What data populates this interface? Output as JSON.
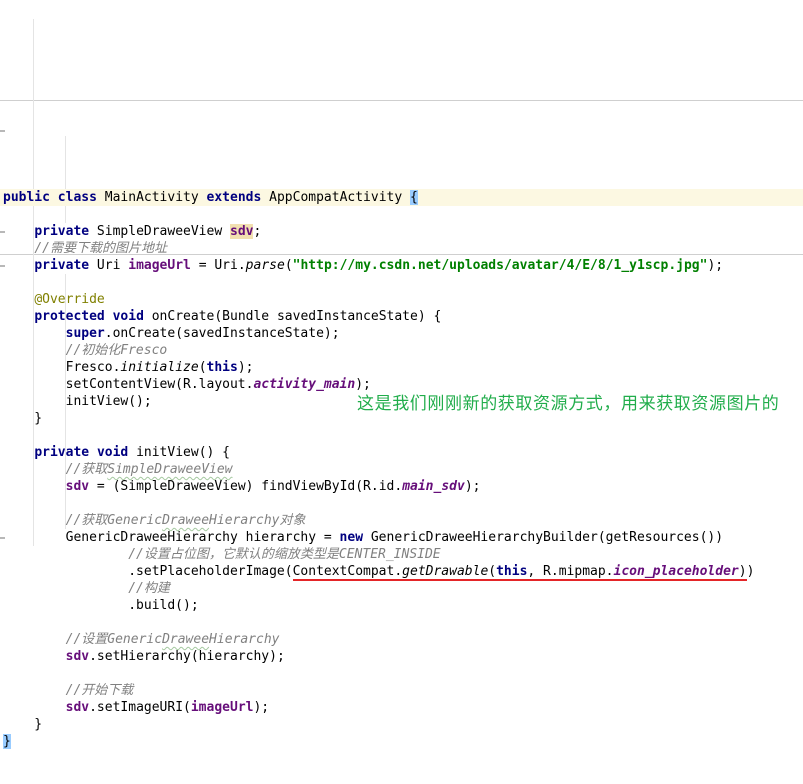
{
  "editor": {
    "note": {
      "text": "这是我们刚刚新的获取资源方式，用来获取资源图片的",
      "color": "#21AD4B"
    },
    "colors": {
      "keyword": "#000080",
      "field": "#660E7A",
      "string": "#008000",
      "comment": "#808080",
      "annotation": "#808000",
      "caret_row": "#FCF8E2",
      "brace_match": "#99CCFF",
      "decl_highlight": "#F2E0B0",
      "red_underline": "#E42528"
    },
    "lines": [
      {
        "cr": true,
        "t": [
          [
            "public",
            "k"
          ],
          [
            " ",
            "p"
          ],
          [
            "class",
            "k"
          ],
          [
            " MainActivity ",
            "p"
          ],
          [
            "extends",
            "k"
          ],
          [
            " AppCompatActivity ",
            "p"
          ],
          [
            "{",
            "p",
            "b"
          ]
        ]
      },
      {
        "t": []
      },
      {
        "t": [
          [
            "    ",
            "p"
          ],
          [
            "private",
            "k"
          ],
          [
            " SimpleDraweeView ",
            "p"
          ],
          [
            "sdv",
            "f",
            "h"
          ],
          [
            ";",
            "p"
          ]
        ]
      },
      {
        "t": [
          [
            "    ",
            "p"
          ],
          [
            "//需要下载的图片地址",
            "c"
          ]
        ]
      },
      {
        "t": [
          [
            "    ",
            "p"
          ],
          [
            "private",
            "k"
          ],
          [
            " Uri ",
            "p"
          ],
          [
            "imageUrl",
            "f"
          ],
          [
            " = Uri.",
            "p"
          ],
          [
            "parse",
            "m"
          ],
          [
            "(",
            "p"
          ],
          [
            "\"http://my.csdn.net/uploads/avatar/4/E/8/1_y1scp.jpg\"",
            "g"
          ],
          [
            ");",
            "p"
          ]
        ]
      },
      {
        "t": []
      },
      {
        "t": [
          [
            "    ",
            "p"
          ],
          [
            "@Override",
            "a"
          ]
        ]
      },
      {
        "t": [
          [
            "    ",
            "p"
          ],
          [
            "protected",
            "k"
          ],
          [
            " ",
            "p"
          ],
          [
            "void",
            "k"
          ],
          [
            " onCreate(Bundle savedInstanceState) {",
            "p"
          ]
        ]
      },
      {
        "t": [
          [
            "        ",
            "p"
          ],
          [
            "super",
            "k"
          ],
          [
            ".onCreate(savedInstanceState);",
            "p"
          ]
        ]
      },
      {
        "t": [
          [
            "        ",
            "p"
          ],
          [
            "//初始化Fresco",
            "c"
          ]
        ]
      },
      {
        "t": [
          [
            "        Fresco.",
            "p"
          ],
          [
            "initialize",
            "m"
          ],
          [
            "(",
            "p"
          ],
          [
            "this",
            "k"
          ],
          [
            ");",
            "p"
          ]
        ]
      },
      {
        "t": [
          [
            "        setContentView(R.layout.",
            "p"
          ],
          [
            "activity_main",
            "s"
          ],
          [
            ");",
            "p"
          ]
        ]
      },
      {
        "t": [
          [
            "        initView();",
            "p"
          ]
        ]
      },
      {
        "t": [
          [
            "    }",
            "p"
          ]
        ]
      },
      {
        "t": []
      },
      {
        "t": [
          [
            "    ",
            "p"
          ],
          [
            "private",
            "k"
          ],
          [
            " ",
            "p"
          ],
          [
            "void",
            "k"
          ],
          [
            " initView() {",
            "p"
          ]
        ]
      },
      {
        "t": [
          [
            "        ",
            "p"
          ],
          [
            "//获取",
            "c"
          ],
          [
            "SimpleDraweeView",
            "w"
          ]
        ]
      },
      {
        "t": [
          [
            "        ",
            "p"
          ],
          [
            "sdv",
            "f"
          ],
          [
            " = (SimpleDraweeView) findViewById(R.id.",
            "p"
          ],
          [
            "main_sdv",
            "s"
          ],
          [
            ");",
            "p"
          ]
        ]
      },
      {
        "t": []
      },
      {
        "t": [
          [
            "        ",
            "p"
          ],
          [
            "//获取Generic",
            "c"
          ],
          [
            "Drawee",
            "w"
          ],
          [
            "Hierarchy对象",
            "c"
          ]
        ]
      },
      {
        "t": [
          [
            "        GenericDraweeHierarchy hierarchy = ",
            "p"
          ],
          [
            "new",
            "k"
          ],
          [
            " GenericDraweeHierarchyBuilder(getResources())",
            "p"
          ]
        ]
      },
      {
        "t": [
          [
            "                ",
            "p"
          ],
          [
            "//设置占位图，它默认的缩放类型是CENTER_INSIDE",
            "c"
          ]
        ]
      },
      {
        "t": [
          [
            "                .setPlaceholderImage(",
            "p"
          ],
          [
            "ContextCompat.",
            "p",
            "u"
          ],
          [
            "getDrawable",
            "m",
            "u"
          ],
          [
            "(",
            "p",
            "u"
          ],
          [
            "this",
            "k",
            "u"
          ],
          [
            ", R.mipmap.",
            "p",
            "u"
          ],
          [
            "icon_placeholder",
            "s",
            "u"
          ],
          [
            ")",
            "p",
            "u"
          ],
          [
            ")",
            "p"
          ]
        ]
      },
      {
        "t": [
          [
            "                ",
            "p"
          ],
          [
            "//构建",
            "c"
          ]
        ]
      },
      {
        "t": [
          [
            "                .build();",
            "p"
          ]
        ]
      },
      {
        "t": []
      },
      {
        "t": [
          [
            "        ",
            "p"
          ],
          [
            "//设置Generic",
            "c"
          ],
          [
            "Drawee",
            "w"
          ],
          [
            "Hierarchy",
            "c"
          ]
        ]
      },
      {
        "t": [
          [
            "        ",
            "p"
          ],
          [
            "sdv",
            "f"
          ],
          [
            ".setHierarchy(hierarchy);",
            "p"
          ]
        ]
      },
      {
        "t": []
      },
      {
        "t": [
          [
            "        ",
            "p"
          ],
          [
            "//开始下载",
            "c"
          ]
        ]
      },
      {
        "t": [
          [
            "        ",
            "p"
          ],
          [
            "sdv",
            "f"
          ],
          [
            ".setImageURI(",
            "p"
          ],
          [
            "imageUrl",
            "f"
          ],
          [
            ");",
            "p"
          ]
        ]
      },
      {
        "t": [
          [
            "    }",
            "p"
          ]
        ]
      },
      {
        "t": [
          [
            "}",
            "p",
            "b"
          ]
        ]
      }
    ]
  }
}
